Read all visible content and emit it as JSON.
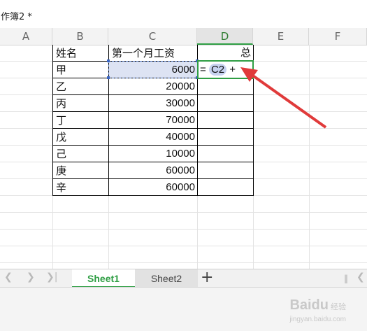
{
  "window": {
    "title": "作簿2 *"
  },
  "columns": [
    "A",
    "B",
    "C",
    "D",
    "E",
    "F"
  ],
  "active_column": "D",
  "table": {
    "header": {
      "name": "姓名",
      "salary": "第一个月工资",
      "total": "总"
    },
    "rows": [
      {
        "name": "甲",
        "salary": "6000"
      },
      {
        "name": "乙",
        "salary": "20000"
      },
      {
        "name": "丙",
        "salary": "30000"
      },
      {
        "name": "丁",
        "salary": "70000"
      },
      {
        "name": "戊",
        "salary": "40000"
      },
      {
        "name": "己",
        "salary": "10000"
      },
      {
        "name": "庚",
        "salary": "60000"
      },
      {
        "name": "辛",
        "salary": "60000"
      }
    ]
  },
  "formula_edit": {
    "prefix": "=",
    "ref": "C2",
    "suffix": "+"
  },
  "sheets": {
    "tabs": [
      "Sheet1",
      "Sheet2"
    ],
    "active": "Sheet1",
    "add_icon": "plus-icon"
  },
  "watermark": {
    "text": "Baidu",
    "suffix": "经验",
    "url": "jingyan.baidu.com"
  },
  "colors": {
    "accent_green": "#2f9e44",
    "arrow_red": "#e03a3a",
    "selection_blue": "#dde3f3"
  }
}
